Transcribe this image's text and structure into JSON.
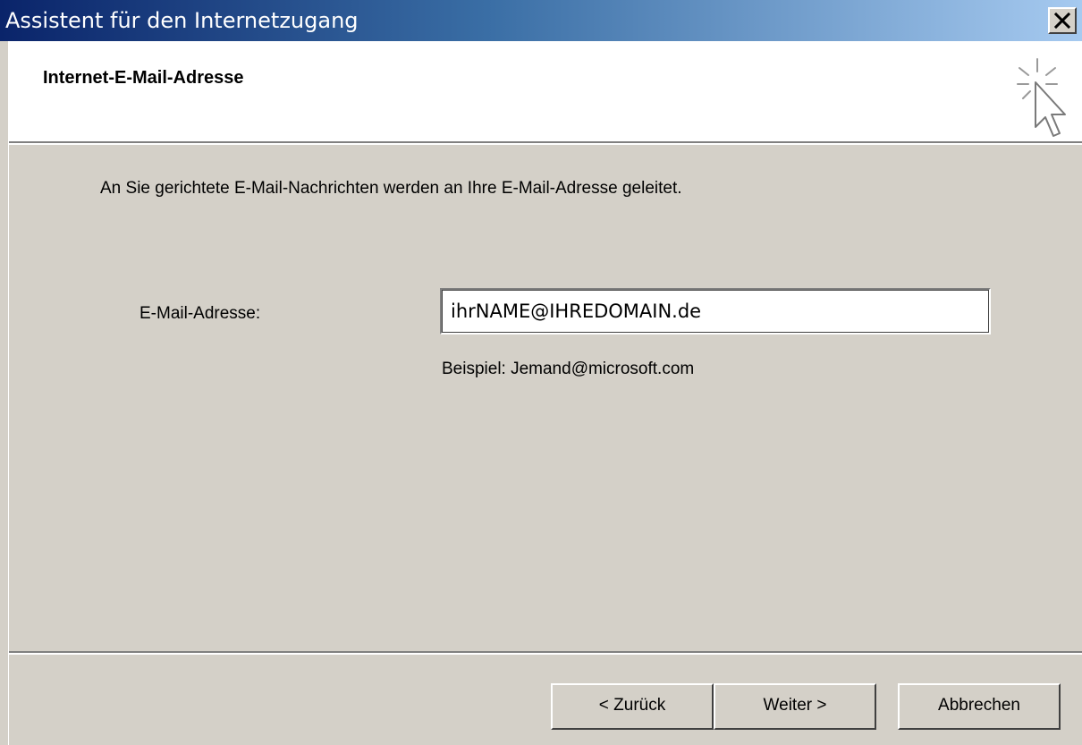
{
  "window": {
    "title": "Assistent für den Internetzugang",
    "close_icon": "close-icon"
  },
  "header": {
    "title": "Internet-E-Mail-Adresse",
    "icon": "wizard-cursor-icon"
  },
  "body": {
    "intro": "An Sie gerichtete E-Mail-Nachrichten werden an Ihre E-Mail-Adresse geleitet.",
    "email_label": "E-Mail-Adresse:",
    "email_value": "ihrNAME@IHREDOMAIN.de",
    "example": "Beispiel: Jemand@microsoft.com"
  },
  "buttons": {
    "back": "< Zurück",
    "next": "Weiter >",
    "cancel": "Abbrechen"
  },
  "colors": {
    "titlebar_start": "#0a246a",
    "titlebar_end": "#a6caf0",
    "face": "#d4d0c8"
  }
}
